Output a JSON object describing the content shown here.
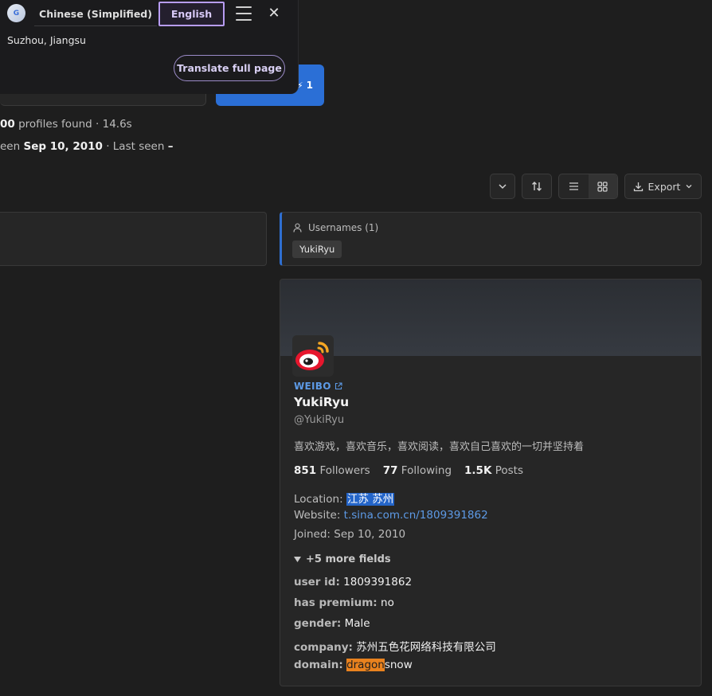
{
  "translate_popup": {
    "source_lang": "Chinese (Simplified)",
    "target_lang": "English",
    "translated_text": "Suzhou, Jiangsu",
    "full_page_label": "Translate full page",
    "close_glyph": "✕"
  },
  "search": {
    "button_suffix": "1"
  },
  "stats": {
    "count_fragment": "00",
    "found_text": " profiles found · 14.6s",
    "seen_prefix": "een ",
    "first_seen": "Sep 10, 2010",
    "last_seen_label": " · Last seen ",
    "last_seen": "–"
  },
  "toolbar": {
    "export_label": "Export"
  },
  "usernames": {
    "title": "Usernames (1)",
    "items": [
      "YukiRyu"
    ]
  },
  "profile": {
    "platform": "WEIBO",
    "name": "YukiRyu",
    "handle": "@YukiRyu",
    "bio": "喜欢游戏，喜欢音乐，喜欢阅读，喜欢自己喜欢的一切并坚持着",
    "followers_count": "851",
    "followers_label": " Followers",
    "following_count": "77",
    "following_label": " Following",
    "posts_count": "1.5K",
    "posts_label": " Posts",
    "location_label": "Location: ",
    "location_value": "江苏 苏州",
    "website_label": "Website: ",
    "website_value": "t.sina.com.cn/1809391862",
    "joined_label": "Joined: ",
    "joined_value": "Sep 10, 2010",
    "more_fields": "+5 more fields",
    "fields": [
      {
        "key": "user id:",
        "value": " 1809391862"
      },
      {
        "key": "has premium:",
        "value": " no"
      },
      {
        "key": "gender:",
        "value": " Male"
      },
      {
        "key": "company:",
        "value": " 苏州五色花网络科技有限公司"
      }
    ],
    "domain_key": "domain:",
    "domain_highlight": "dragon",
    "domain_rest": "snow"
  },
  "colors": {
    "accent_blue": "#2b6fd6",
    "highlight_orange": "#e9821e",
    "card_bg": "#262626",
    "page_bg": "#1e1e1e"
  }
}
